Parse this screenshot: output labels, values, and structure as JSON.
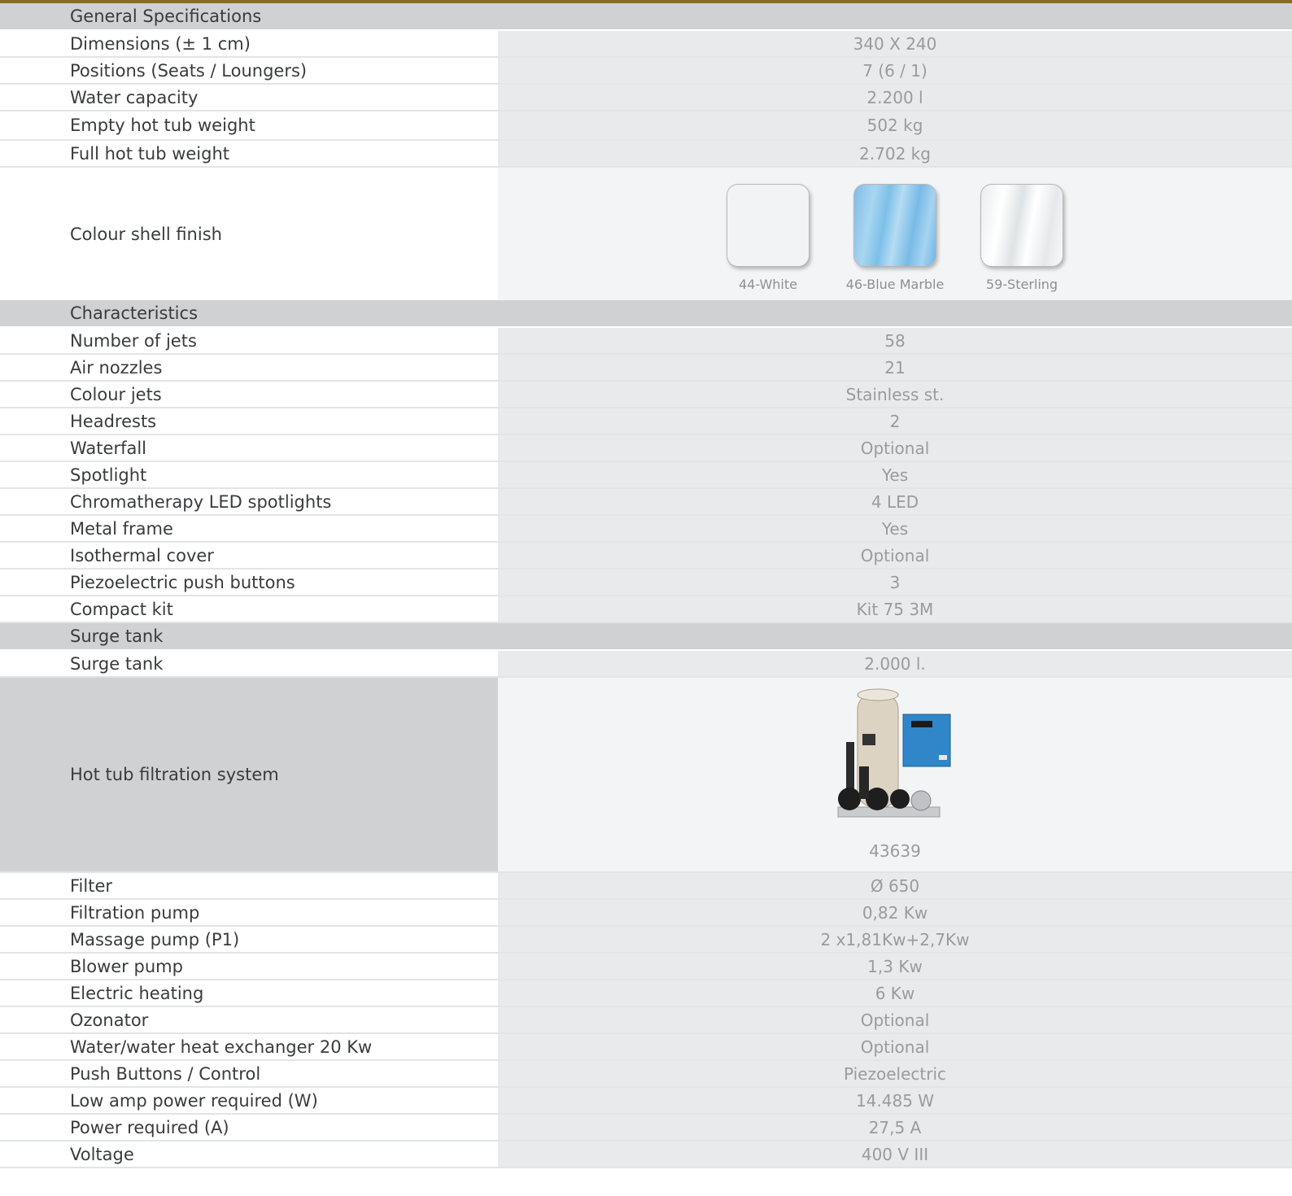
{
  "sections": [
    {
      "title": "General Specifications",
      "rows": [
        {
          "label": "Dimensions (± 1 cm)",
          "value": "340 X 240"
        },
        {
          "label": "Positions (Seats / Loungers)",
          "value": "7 (6 / 1)"
        },
        {
          "label": "Water capacity",
          "value": "2.200 l"
        },
        {
          "label": "Empty hot tub weight",
          "value": "502 kg"
        },
        {
          "label": "Full hot tub weight",
          "value": "2.702 kg"
        }
      ],
      "colour_finish": {
        "label": "Colour shell finish",
        "options": [
          "44-White",
          "46-Blue Marble",
          "59-Sterling"
        ]
      }
    },
    {
      "title": "Characteristics",
      "rows": [
        {
          "label": "Number of jets",
          "value": "58"
        },
        {
          "label": "Air nozzles",
          "value": "21"
        },
        {
          "label": "Colour jets",
          "value": "Stainless st."
        },
        {
          "label": "Headrests",
          "value": "2"
        },
        {
          "label": "Waterfall",
          "value": "Optional"
        },
        {
          "label": "Spotlight",
          "value": "Yes"
        },
        {
          "label": "Chromatherapy LED spotlights",
          "value": "4 LED"
        },
        {
          "label": "Metal frame",
          "value": "Yes"
        },
        {
          "label": "Isothermal cover",
          "value": "Optional"
        },
        {
          "label": "Piezoelectric push buttons",
          "value": "3"
        },
        {
          "label": "Compact kit",
          "value": "Kit 75 3M"
        }
      ]
    },
    {
      "title": "Surge tank",
      "rows": [
        {
          "label": "Surge tank",
          "value": "2.000 l."
        }
      ],
      "filtration": {
        "label": "Hot tub filtration system",
        "code": "43639"
      },
      "rows_after": [
        {
          "label": "Filter",
          "value": "Ø 650"
        },
        {
          "label": "Filtration pump",
          "value": "0,82 Kw"
        },
        {
          "label": "Massage pump (P1)",
          "value": "2 x1,81Kw+2,7Kw"
        },
        {
          "label": "Blower pump",
          "value": "1,3 Kw"
        },
        {
          "label": "Electric heating",
          "value": "6 Kw"
        },
        {
          "label": "Ozonator",
          "value": "Optional"
        },
        {
          "label": "Water/water heat exchanger 20 Kw",
          "value": "Optional"
        },
        {
          "label": "Push Buttons / Control",
          "value": "Piezoelectric"
        },
        {
          "label": "Low amp power required (W)",
          "value": "14.485 W"
        },
        {
          "label": "Power required (A)",
          "value": "27,5 A"
        },
        {
          "label": "Voltage",
          "value": "400 V III"
        }
      ]
    }
  ],
  "colors": {
    "accent_bar": "#8a6a2a",
    "header_bg": "#d0d1d3",
    "value_bg": "#e9eaec"
  }
}
